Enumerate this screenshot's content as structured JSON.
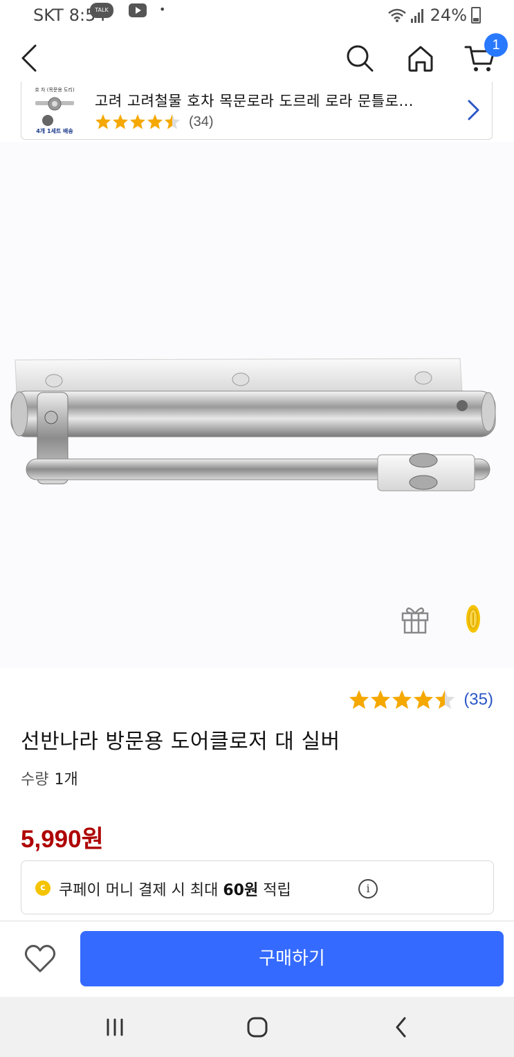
{
  "status_bar": {
    "carrier": "SKT",
    "time": "8:54",
    "talk_badge": "TALK",
    "dot": "•",
    "battery": "24%",
    "icons": [
      "kakaotalk-icon",
      "youtube-icon",
      "wifi-icon",
      "signal-icon",
      "battery-icon"
    ]
  },
  "header": {
    "icons": [
      "back-arrow-icon",
      "search-icon",
      "home-icon",
      "cart-icon"
    ],
    "cart_count": "1",
    "badge_color": "#2979ff"
  },
  "related_product": {
    "title": "고려 고려철물 호차 목문로라 도르레 로라 문틀로...",
    "rating_stars": 4.5,
    "review_count": "(34)",
    "thumb_caption_top": "호 차 (목문용 도리)",
    "thumb_caption_bottom": "4개 1세트 배송"
  },
  "product": {
    "image_alt": "silver door closer",
    "rating_stars": 4.5,
    "review_count": "(35)",
    "title": "선반나라 방문용 도어클로저 대 실버",
    "qty_label": "수량",
    "qty_value": "1개",
    "price": "5,990원",
    "price_color": "#ae0000",
    "star_color": "#f5a800"
  },
  "coupay": {
    "text_before": "쿠페이 머니 결제 시 최대 ",
    "amount": "60원",
    "text_after": " 적립",
    "info_icon": "i"
  },
  "action_bar": {
    "buy_label": "구매하기",
    "buy_color": "#346aff"
  },
  "android_nav": {
    "icons": [
      "recent-apps-icon",
      "home-circle-icon",
      "back-chevron-icon"
    ]
  }
}
